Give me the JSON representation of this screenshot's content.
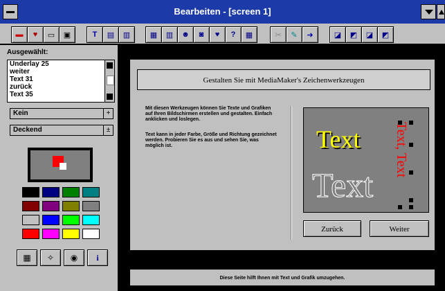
{
  "window": {
    "title": "Bearbeiten - [screen 1]"
  },
  "toolbar": {
    "icons": [
      "new-icon",
      "open-icon",
      "save-icon",
      "print-icon",
      "text-icon",
      "frame-icon",
      "page-icon",
      "image-icon",
      "chart-icon",
      "person-icon",
      "stamp-icon",
      "heart-icon",
      "help-icon",
      "grid-icon",
      "cut-icon",
      "edit-icon",
      "forward-icon",
      "align-icon",
      "align-icon",
      "align-icon",
      "align-icon"
    ]
  },
  "left_panel": {
    "title": "Ausgewählt:",
    "layers": [
      "Underlay 25",
      "weiter",
      "Text 31",
      "zurück",
      "Text 35"
    ],
    "combo1": "Kein",
    "combo2": "Deckend",
    "palette": [
      "#000000",
      "#000080",
      "#008000",
      "#008080",
      "#800000",
      "#800080",
      "#808000",
      "#808080",
      "#c0c0c0",
      "#0000ff",
      "#00ff00",
      "#00ffff",
      "#ff0000",
      "#ff00ff",
      "#ffff00",
      "#ffffff"
    ],
    "preview_fg": "#ff0000",
    "preview_bg": "#808080",
    "tools": [
      "grid-tool-icon",
      "wand-tool-icon",
      "eye-tool-icon",
      "info-tool-icon"
    ]
  },
  "canvas": {
    "header": "Gestalten Sie mit MediaMaker's Zeichenwerkzeugen",
    "paragraph1": "Mit diesen Werkzeugen können Sie Texte und Grafiken auf Ihren Bildschirmen erstellen und gestalten. Einfach anklicken und loslegen.",
    "paragraph2": "Text kann in jeder Farbe, Größe und Richtung gezeichnet werden. Probieren Sie es aus und sehen Sie, was möglich ist.",
    "demo_text_yellow": "Text",
    "demo_text_outline": "Text",
    "demo_text_vertical": "Text, Text",
    "back_button": "Zurück",
    "next_button": "Weiter",
    "colors": {
      "yellow": "#ffff00",
      "red": "#ff0000",
      "gray": "#808080"
    }
  },
  "status": {
    "text": "Diese Seite hilft Ihnen mit Text und Grafik umzugehen."
  }
}
